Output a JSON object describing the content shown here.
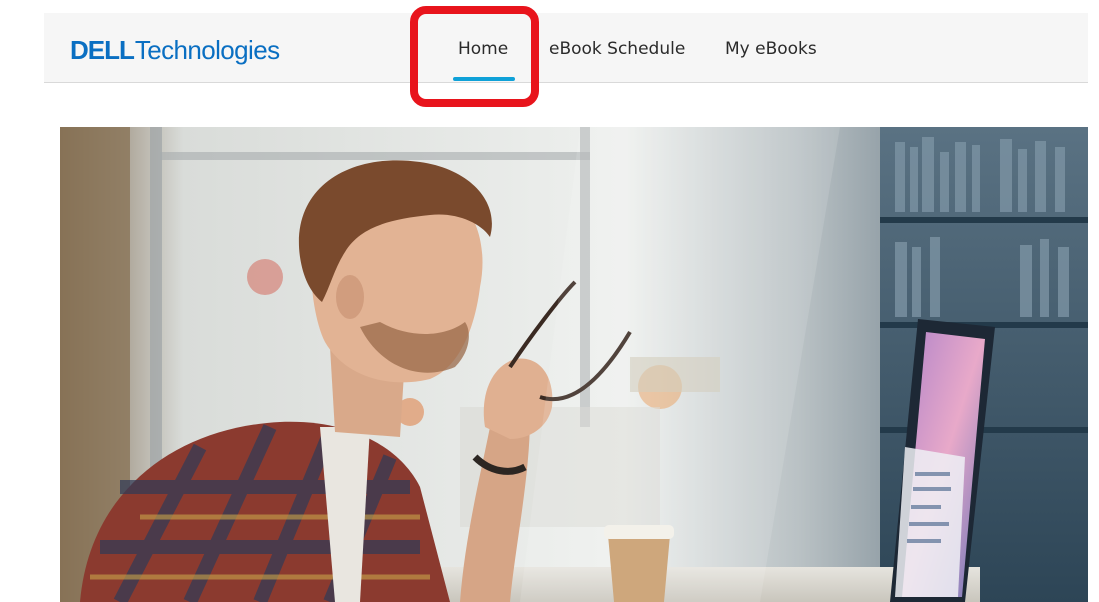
{
  "brand": {
    "logo_part1": "DELL",
    "logo_part2": "Technologies",
    "color": "#0a6fc2"
  },
  "nav": {
    "items": [
      {
        "label": "Home",
        "active": true
      },
      {
        "label": "eBook Schedule",
        "active": false
      },
      {
        "label": "My eBooks",
        "active": false
      }
    ],
    "active_color": "#0fa1d8",
    "highlight_color": "#e8141c"
  },
  "hero": {
    "icon": "hero-photo-man-at-monitor"
  }
}
